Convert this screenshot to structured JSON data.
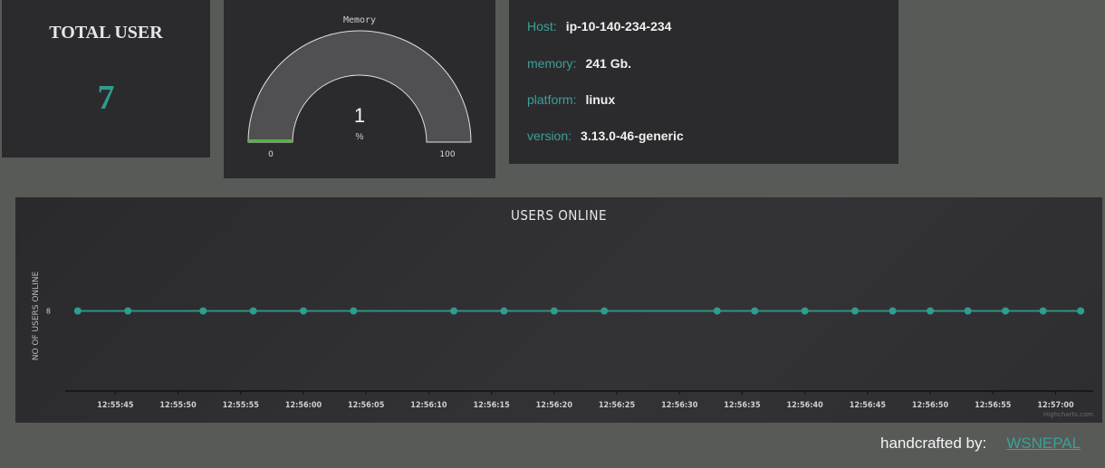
{
  "total_users": {
    "title": "TOTAL USER",
    "value": "7"
  },
  "memory_gauge": {
    "title": "Memory",
    "value": 1,
    "display_value": "1",
    "unit": "%",
    "min": 0,
    "max": 100,
    "min_label": "0",
    "max_label": "100"
  },
  "system_info": [
    {
      "key": "Host:",
      "value": "ip-10-140-234-234"
    },
    {
      "key": "memory:",
      "value": "241 Gb."
    },
    {
      "key": "platform:",
      "value": "linux"
    },
    {
      "key": "version:",
      "value": "3.13.0-46-generic"
    }
  ],
  "chart_data": {
    "type": "line",
    "title": "USERS ONLINE",
    "ylabel": "NO OF USERS ONLINE",
    "xlabel": "",
    "ylim": [
      7,
      9
    ],
    "ytick_labels": [
      "8"
    ],
    "xlim": [
      "12:55:41",
      "12:57:03"
    ],
    "xtick_labels": [
      "12:55:45",
      "12:55:50",
      "12:55:55",
      "12:56:00",
      "12:56:05",
      "12:56:10",
      "12:56:15",
      "12:56:20",
      "12:56:25",
      "12:56:30",
      "12:56:35",
      "12:56:40",
      "12:56:45",
      "12:56:50",
      "12:56:55",
      "12:57:00"
    ],
    "credit": "Highcharts.com",
    "series": [
      {
        "x": [
          "12:55:42",
          "12:55:46",
          "12:55:52",
          "12:55:56",
          "12:56:00",
          "12:56:04",
          "12:56:12",
          "12:56:16",
          "12:56:20",
          "12:56:24",
          "12:56:33",
          "12:56:36",
          "12:56:40",
          "12:56:44",
          "12:56:47",
          "12:56:50",
          "12:56:53",
          "12:56:56",
          "12:56:59",
          "12:57:02"
        ],
        "values": [
          8,
          8,
          8,
          8,
          8,
          8,
          8,
          8,
          8,
          8,
          8,
          8,
          8,
          8,
          8,
          8,
          8,
          8,
          8,
          8
        ]
      }
    ],
    "colors": {
      "series": "#2f9c8f",
      "axis": "#111111",
      "text": "#cfcfcf"
    }
  },
  "footer": {
    "label": "handcrafted by:",
    "link_text": "WSNEPAL"
  },
  "colors": {
    "accent": "#2f9c8f",
    "gauge_fill": "#4fb83a",
    "gauge_band": "#505052",
    "background": "#585a58",
    "panel": "#2b2b2d"
  }
}
